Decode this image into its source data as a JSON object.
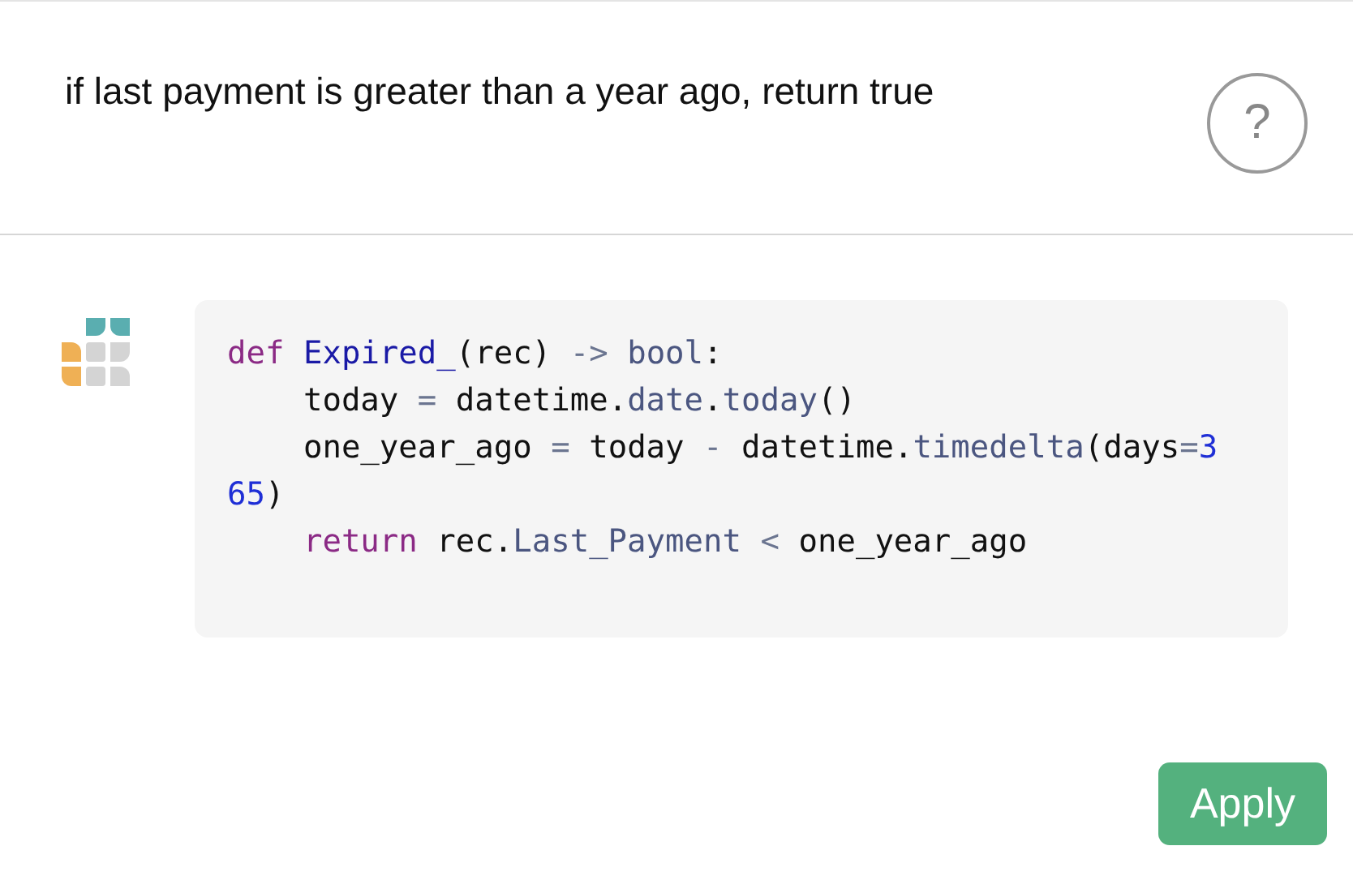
{
  "prompt": {
    "text": "if last payment is greater than a year ago, return true",
    "help": "?"
  },
  "code": {
    "lines": [
      [
        {
          "kind": "keyword",
          "text": "def "
        },
        {
          "kind": "name",
          "text": "Expired_"
        },
        {
          "kind": "plain",
          "text": "(rec) "
        },
        {
          "kind": "op",
          "text": "-> "
        },
        {
          "kind": "attr",
          "text": "bool"
        },
        {
          "kind": "plain",
          "text": ":"
        }
      ],
      [
        {
          "kind": "plain",
          "text": "    today "
        },
        {
          "kind": "op",
          "text": "="
        },
        {
          "kind": "plain",
          "text": " datetime."
        },
        {
          "kind": "attr",
          "text": "date"
        },
        {
          "kind": "plain",
          "text": "."
        },
        {
          "kind": "attr",
          "text": "today"
        },
        {
          "kind": "plain",
          "text": "()"
        }
      ],
      [
        {
          "kind": "plain",
          "text": "    one_year_ago "
        },
        {
          "kind": "op",
          "text": "="
        },
        {
          "kind": "plain",
          "text": " today "
        },
        {
          "kind": "op",
          "text": "-"
        },
        {
          "kind": "plain",
          "text": " datetime."
        },
        {
          "kind": "attr",
          "text": "timedelta"
        },
        {
          "kind": "plain",
          "text": "(days"
        },
        {
          "kind": "op",
          "text": "="
        },
        {
          "kind": "number",
          "text": "3"
        }
      ],
      [
        {
          "kind": "number",
          "text": "65"
        },
        {
          "kind": "plain",
          "text": ")"
        }
      ],
      [
        {
          "kind": "keyword",
          "text": "    return"
        },
        {
          "kind": "plain",
          "text": " rec."
        },
        {
          "kind": "attr",
          "text": "Last_Payment"
        },
        {
          "kind": "op",
          "text": " < "
        },
        {
          "kind": "plain",
          "text": "one_year_ago"
        }
      ]
    ]
  },
  "apply_button": "Apply"
}
